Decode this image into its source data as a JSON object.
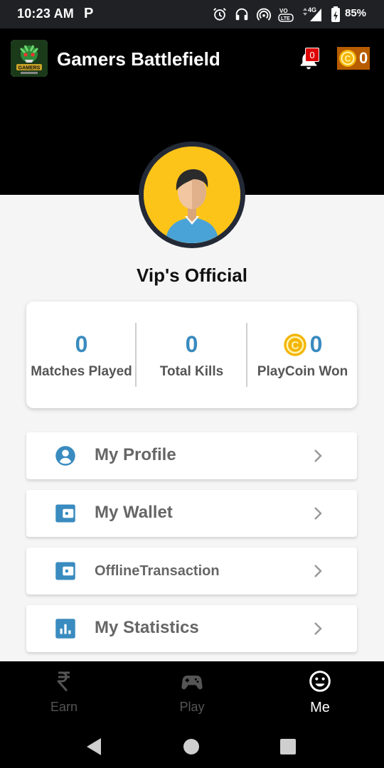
{
  "status_bar": {
    "time": "10:23 AM",
    "app_indicator": "P",
    "network": "4G",
    "battery": "85%"
  },
  "app_bar": {
    "title": "Gamers Battlefield",
    "notification_count": "0",
    "coin_balance": "0"
  },
  "profile": {
    "username": "Vip's Official"
  },
  "stats": [
    {
      "value": "0",
      "label": "Matches Played"
    },
    {
      "value": "0",
      "label": "Total Kills"
    },
    {
      "value": "0",
      "label": "PlayCoin Won"
    }
  ],
  "menu": [
    {
      "label": "My Profile",
      "icon": "account-circle-icon"
    },
    {
      "label": "My Wallet",
      "icon": "wallet-icon"
    },
    {
      "label": "OfflineTransaction",
      "icon": "wallet-icon"
    },
    {
      "label": "My Statistics",
      "icon": "bar-chart-icon"
    }
  ],
  "bottom_nav": [
    {
      "label": "Earn",
      "icon": "rupee-icon",
      "active": false
    },
    {
      "label": "Play",
      "icon": "gamepad-icon",
      "active": false
    },
    {
      "label": "Me",
      "icon": "smiley-icon",
      "active": true
    }
  ],
  "colors": {
    "accent": "#3a8bbf",
    "coin": "#f4b400",
    "badge": "#e00000",
    "avatar_bg": "#fcc419"
  }
}
